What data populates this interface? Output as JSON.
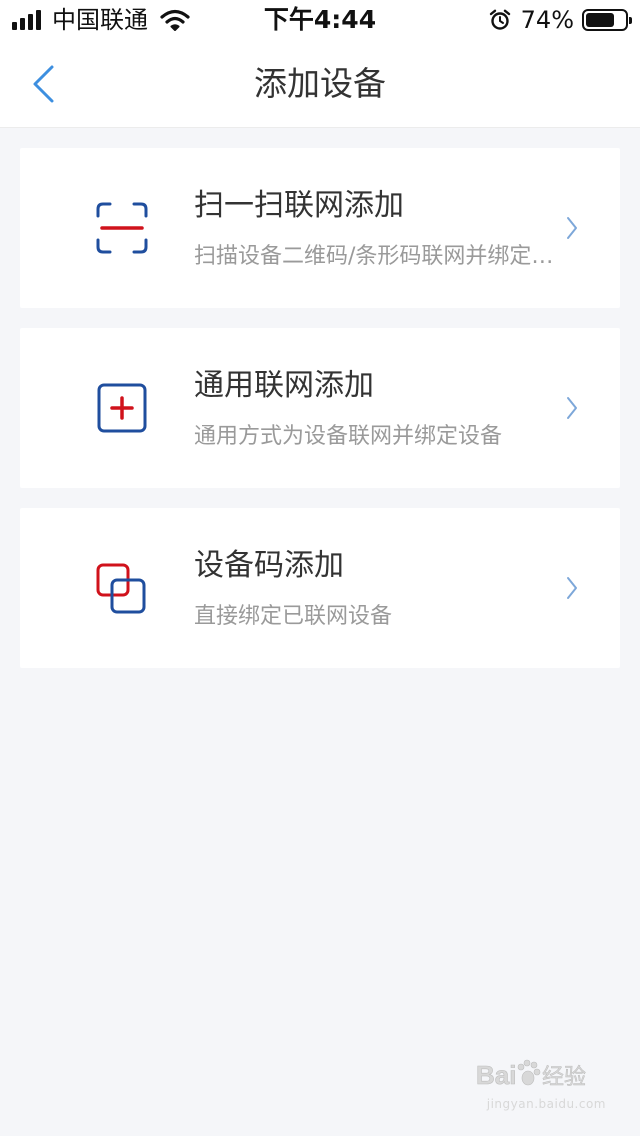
{
  "status_bar": {
    "carrier": "中国联通",
    "time": "下午4:44",
    "battery_percent": "74%",
    "battery_level": 0.74,
    "icons": [
      "signal-icon",
      "wifi-icon",
      "alarm-icon",
      "battery-icon"
    ]
  },
  "nav": {
    "title": "添加设备",
    "back_icon": "chevron-left-icon"
  },
  "options": [
    {
      "title": "扫一扫联网添加",
      "subtitle": "扫描设备二维码/条形码联网并绑定设备",
      "icon": "scan-icon"
    },
    {
      "title": "通用联网添加",
      "subtitle": "通用方式为设备联网并绑定设备",
      "icon": "add-square-icon"
    },
    {
      "title": "设备码添加",
      "subtitle": "直接绑定已联网设备",
      "icon": "link-squares-icon"
    }
  ],
  "colors": {
    "accent_blue": "#1f4e9e",
    "accent_red": "#d0121b",
    "back_blue": "#3d8fe0",
    "chevron_blue": "#7da7d9",
    "background": "#f5f6f9"
  },
  "watermark": {
    "logo_text": "Bai 经验",
    "url": "jingyan.baidu.com"
  }
}
